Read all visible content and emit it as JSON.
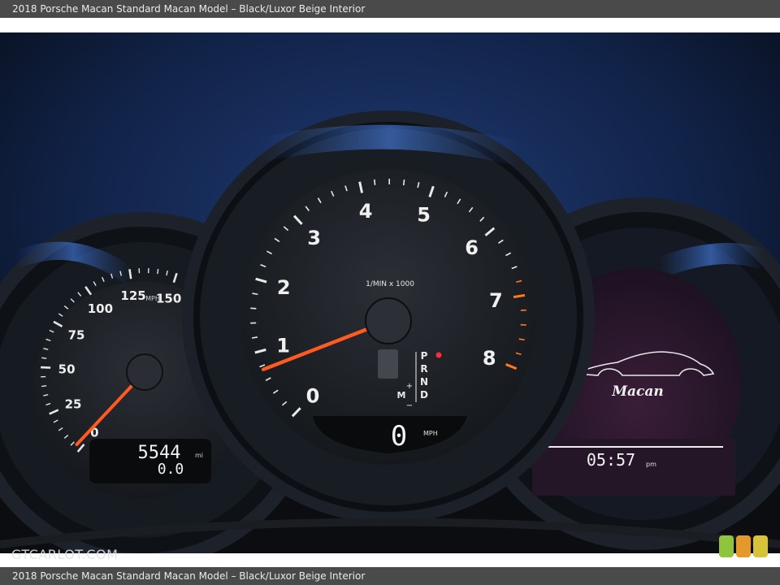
{
  "caption": "2018 Porsche Macan Standard Macan Model – Black/Luxor Beige Interior",
  "watermark": "GTCARLOT.COM",
  "tachometer": {
    "numbers": [
      "0",
      "1",
      "2",
      "3",
      "4",
      "5",
      "6",
      "7",
      "8"
    ],
    "unit_label": "1/MIN x 1000",
    "needle_value": 0.8,
    "gear_indicator": [
      "P",
      "R",
      "N",
      "D"
    ],
    "manual_labels": [
      "M",
      "+",
      "−"
    ],
    "digital_speed": "0",
    "digital_speed_unit": "MPH"
  },
  "speedometer": {
    "numbers": [
      "0",
      "25",
      "50",
      "75",
      "100",
      "125",
      "150"
    ],
    "unit_label": "MPH",
    "needle_value": 3,
    "odometer": "5544",
    "odometer_unit": "mi",
    "trip": "0.0"
  },
  "right_display": {
    "model_name": "Macan",
    "clock": "05:57",
    "clock_suffix": "pm"
  },
  "colors": {
    "dot_green": "#8fc43f",
    "dot_orange": "#e39a2b",
    "dot_yellow": "#d8c23a",
    "needle": "#ff5a1f"
  }
}
